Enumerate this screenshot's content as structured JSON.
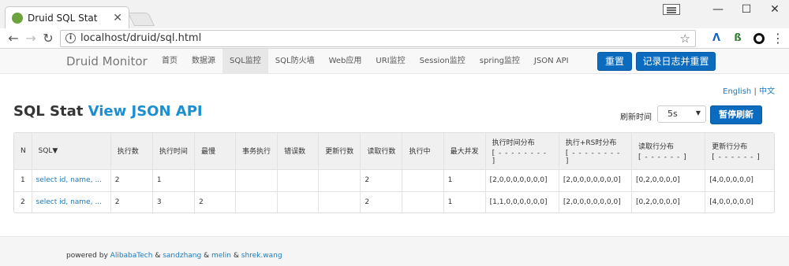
{
  "browser": {
    "tab_title": "Druid SQL Stat",
    "url": "localhost/druid/sql.html",
    "win_min": "—",
    "win_max": "☐",
    "win_close": "✕"
  },
  "nav": {
    "brand": "Druid Monitor",
    "items": [
      "首页",
      "数据源",
      "SQL监控",
      "SQL防火墙",
      "Web应用",
      "URI监控",
      "Session监控",
      "spring监控",
      "JSON API"
    ],
    "active_index": 2,
    "reset_label": "重置",
    "log_reset_label": "记录日志并重置"
  },
  "lang": {
    "english": "English",
    "sep": "|",
    "chinese": "中文"
  },
  "page": {
    "title": "SQL Stat",
    "json_link": "View JSON API",
    "refresh_label": "刷新时间",
    "refresh_value": "5s",
    "pause_label": "暂停刷新"
  },
  "table": {
    "headers": [
      "N",
      "SQL▼",
      "执行数",
      "执行时间",
      "最慢",
      "事务执行",
      "错误数",
      "更新行数",
      "读取行数",
      "执行中",
      "最大并发",
      "执行时间分布",
      "执行+RS时分布",
      "读取行分布",
      "更新行分布"
    ],
    "subheaders": {
      "11": "[ - - - - - - - - ]",
      "12": "[ - - - - - - - - ]",
      "13": "[ - - - - - - ]",
      "14": "[ - - - - - - ]"
    },
    "rows": [
      [
        "1",
        "select id, name, ...",
        "2",
        "1",
        "",
        "",
        "",
        "",
        "2",
        "",
        "1",
        "[2,0,0,0,0,0,0,0]",
        "[2,0,0,0,0,0,0,0]",
        "[0,2,0,0,0,0]",
        "[4,0,0,0,0,0]"
      ],
      [
        "2",
        "select id, name, ...",
        "2",
        "3",
        "2",
        "",
        "",
        "",
        "2",
        "",
        "1",
        "[1,1,0,0,0,0,0,0]",
        "[2,0,0,0,0,0,0,0]",
        "[0,2,0,0,0,0]",
        "[4,0,0,0,0,0]"
      ]
    ]
  },
  "footer": {
    "prefix": "powered by",
    "amp": "&",
    "authors": [
      "AlibabaTech",
      "sandzhang",
      "melin",
      "shrek.wang"
    ]
  }
}
